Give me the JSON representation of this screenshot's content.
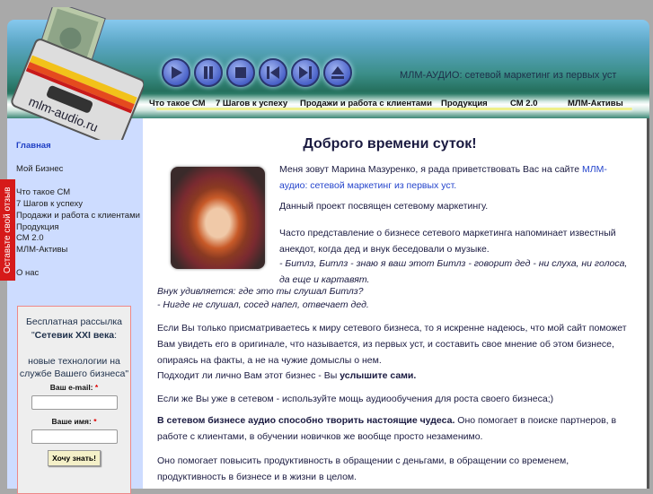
{
  "header": {
    "site_title": "МЛМ-АУДИО: сетевой маркетинг из первых уст",
    "logo_text": "mlm-audio.ru",
    "controls": [
      "play-icon",
      "pause-icon",
      "stop-icon",
      "prev-icon",
      "next-icon",
      "eject-icon"
    ],
    "nav": [
      "Что такое СМ",
      "7 Шагов к успеху",
      "Продажи и работа с клиентами",
      "Продукция",
      "СМ 2.0",
      "МЛМ-Активы"
    ]
  },
  "feedback_tab": "Оставьте свой отзыв",
  "sidebar": {
    "items": [
      "Главная",
      "Мой Бизнес",
      "Что такое СМ",
      "7 Шагов к успеху",
      "Продажи и работа с клиентами",
      "Продукция",
      "СМ 2.0",
      "МЛМ-Активы",
      "О нас"
    ]
  },
  "subscribe": {
    "line1": "Бесплатная рассылка",
    "quote_open": "\"",
    "name": "Сетевик XXI века",
    "after_name": ":",
    "line2": "новые технологии на службе Вашего бизнеса\"",
    "email_label": "Ваш e-mail:",
    "name_label": "Ваше имя:",
    "required": "*",
    "button": "Хочу знать!"
  },
  "main": {
    "title": "Доброго времени суток!",
    "p1": "Меня зовут Марина Мазуренко, я рада приветствовать Вас на сайте ",
    "p1_link": "МЛМ-аудио: сетевой маркетинг из первых уст.",
    "p2": "Данный проект посвящен сетевому маркетингу.",
    "p3": "Часто представление о бизнесе сетевого маркетинга напоминает известный анекдот, когда дед и внук беседовали о музыке.",
    "q1": "- Битлз, Битлз - знаю я ваш этот Битлз - говорит дед - ни слуха, ни голоса, да еще и картавят.",
    "q2": "Внук удивляется: где это ты слушал Битлз?",
    "q3": "- Нигде не слушал, сосед напел, отвечает дед.",
    "p4": "Если Вы только присматриваетесь к миру сетевого бизнеса, то я искренне надеюсь, что мой сайт поможет Вам увидеть его в оригинале, что называется, из первых уст, и составить свое мнение об этом бизнесе, опираясь на факты, а не на чужие домыслы о нем.",
    "p5": "Подходит ли лично Вам этот бизнес - Вы ",
    "p5_bold": "услышите сами.",
    "p6": "Если же Вы уже в сетевом - используйте мощь аудиообучения для роста своего бизнеса;)",
    "p7_bold": "В сетевом бизнесе аудио способно творить настоящие чудеса.",
    "p7": " Оно помогает в поиске партнеров, в работе с клиентами, в обучении новичков же вообще просто незаменимо.",
    "p8": "Оно помогает повысить продуктивность в обращении с деньгами, в обращении со временем, продуктивность в бизнесе и в жизни в целом."
  }
}
